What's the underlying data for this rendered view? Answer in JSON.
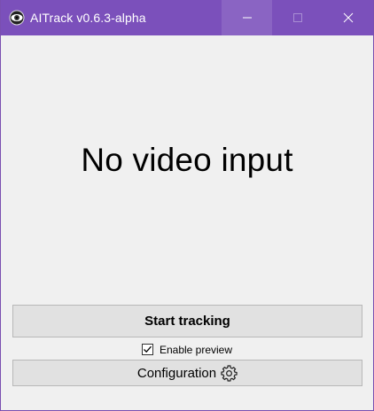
{
  "window": {
    "title": "AITrack v0.6.3-alpha",
    "controls": {
      "minimize_icon": "minimize-icon",
      "maximize_icon": "maximize-icon",
      "close_icon": "close-icon"
    },
    "accent_color": "#7b50bb"
  },
  "main": {
    "video_status": "No video input"
  },
  "actions": {
    "start_label": "Start tracking",
    "preview_label": "Enable preview",
    "preview_checked": true,
    "config_label": "Configuration",
    "config_icon": "gear-icon"
  }
}
